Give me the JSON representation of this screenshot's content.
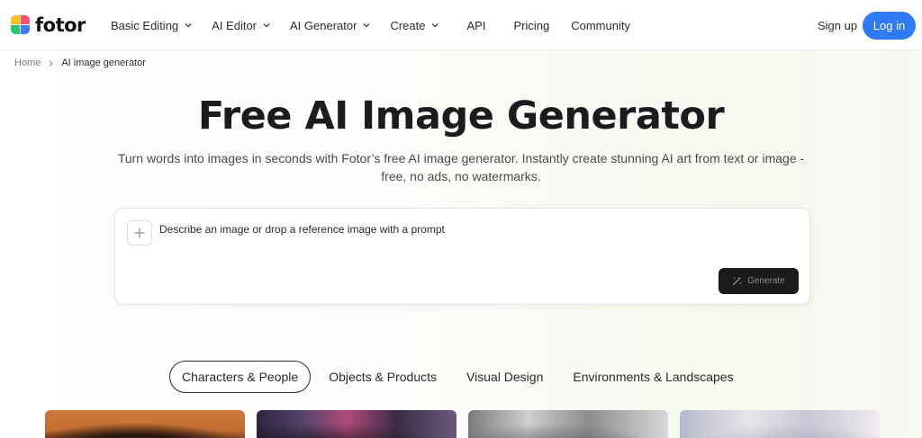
{
  "brand": {
    "name": "fotor"
  },
  "nav": {
    "items": [
      {
        "label": "Basic Editing",
        "has_dropdown": true
      },
      {
        "label": "AI Editor",
        "has_dropdown": true
      },
      {
        "label": "AI Generator",
        "has_dropdown": true
      },
      {
        "label": "Create",
        "has_dropdown": true
      },
      {
        "label": "API",
        "has_dropdown": false
      },
      {
        "label": "Pricing",
        "has_dropdown": false
      },
      {
        "label": "Community",
        "has_dropdown": false
      }
    ],
    "signup_label": "Sign up",
    "login_label": "Log in"
  },
  "breadcrumb": {
    "home": "Home",
    "current": "AI image generator"
  },
  "hero": {
    "title": "Free AI Image Generator",
    "subtitle": "Turn words into images in seconds with Fotor’s free AI image generator. Instantly create stunning AI art from text or image - free, no ads, no watermarks."
  },
  "prompt": {
    "placeholder": "Describe an image or drop a reference image with a prompt",
    "generate_label": "Generate"
  },
  "tabs": [
    {
      "label": "Characters & People",
      "active": true
    },
    {
      "label": "Objects & Products",
      "active": false
    },
    {
      "label": "Visual Design",
      "active": false
    },
    {
      "label": "Environments & Landscapes",
      "active": false
    }
  ],
  "colors": {
    "accent": "#2f7bf5",
    "generate_bg": "#1b1b1e",
    "text": "#1f1f23"
  },
  "icons": [
    "chevron-down-icon",
    "chevron-right-icon",
    "plus-icon",
    "magic-wand-icon"
  ]
}
